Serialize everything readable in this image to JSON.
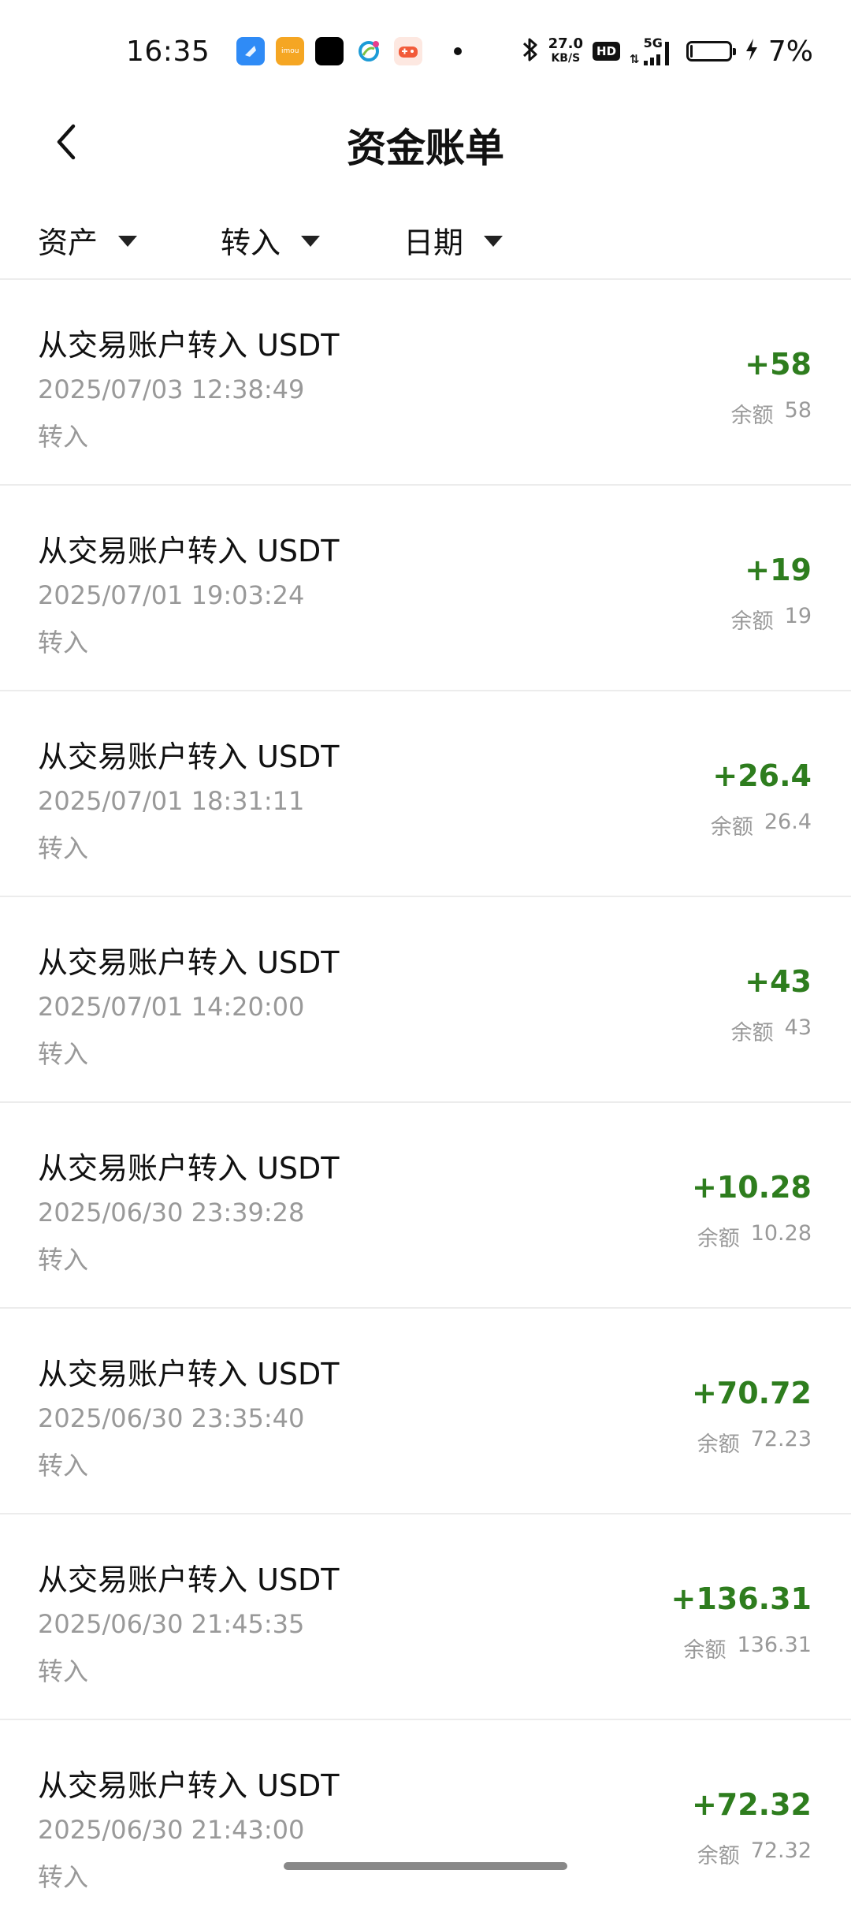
{
  "status_bar": {
    "time": "16:35",
    "net_speed_value": "27.0",
    "net_speed_unit": "KB/S",
    "hd": "HD",
    "network": "5G",
    "battery_percent": "7%",
    "battery_level": 0.07,
    "app_icons": [
      {
        "name": "blue-app-icon",
        "color": "#2f8bf6"
      },
      {
        "name": "imou-app-icon",
        "color": "#f5a623",
        "label": "imou"
      },
      {
        "name": "black-app-icon",
        "color": "#000000"
      },
      {
        "name": "china-mobile-icon",
        "color": "#1c9bd6"
      },
      {
        "name": "game-app-icon",
        "color": "#f25b3a"
      }
    ]
  },
  "header": {
    "title": "资金账单"
  },
  "filters": [
    {
      "label": "资产"
    },
    {
      "label": "转入"
    },
    {
      "label": "日期"
    }
  ],
  "records": [
    {
      "title": "从交易账户转入 USDT",
      "time": "2025/07/03 12:38:49",
      "type": "转入",
      "amount": "+58",
      "balance_label": "余额",
      "balance": "58"
    },
    {
      "title": "从交易账户转入 USDT",
      "time": "2025/07/01 19:03:24",
      "type": "转入",
      "amount": "+19",
      "balance_label": "余额",
      "balance": "19"
    },
    {
      "title": "从交易账户转入 USDT",
      "time": "2025/07/01 18:31:11",
      "type": "转入",
      "amount": "+26.4",
      "balance_label": "余额",
      "balance": "26.4"
    },
    {
      "title": "从交易账户转入 USDT",
      "time": "2025/07/01 14:20:00",
      "type": "转入",
      "amount": "+43",
      "balance_label": "余额",
      "balance": "43"
    },
    {
      "title": "从交易账户转入 USDT",
      "time": "2025/06/30 23:39:28",
      "type": "转入",
      "amount": "+10.28",
      "balance_label": "余额",
      "balance": "10.28"
    },
    {
      "title": "从交易账户转入 USDT",
      "time": "2025/06/30 23:35:40",
      "type": "转入",
      "amount": "+70.72",
      "balance_label": "余额",
      "balance": "72.23"
    },
    {
      "title": "从交易账户转入 USDT",
      "time": "2025/06/30 21:45:35",
      "type": "转入",
      "amount": "+136.31",
      "balance_label": "余额",
      "balance": "136.31"
    },
    {
      "title": "从交易账户转入 USDT",
      "time": "2025/06/30 21:43:00",
      "type": "转入",
      "amount": "+72.32",
      "balance_label": "余额",
      "balance": "72.32"
    }
  ],
  "colors": {
    "positive_amount": "#2e7d1e",
    "secondary_text": "#999999",
    "divider": "#ececec"
  }
}
